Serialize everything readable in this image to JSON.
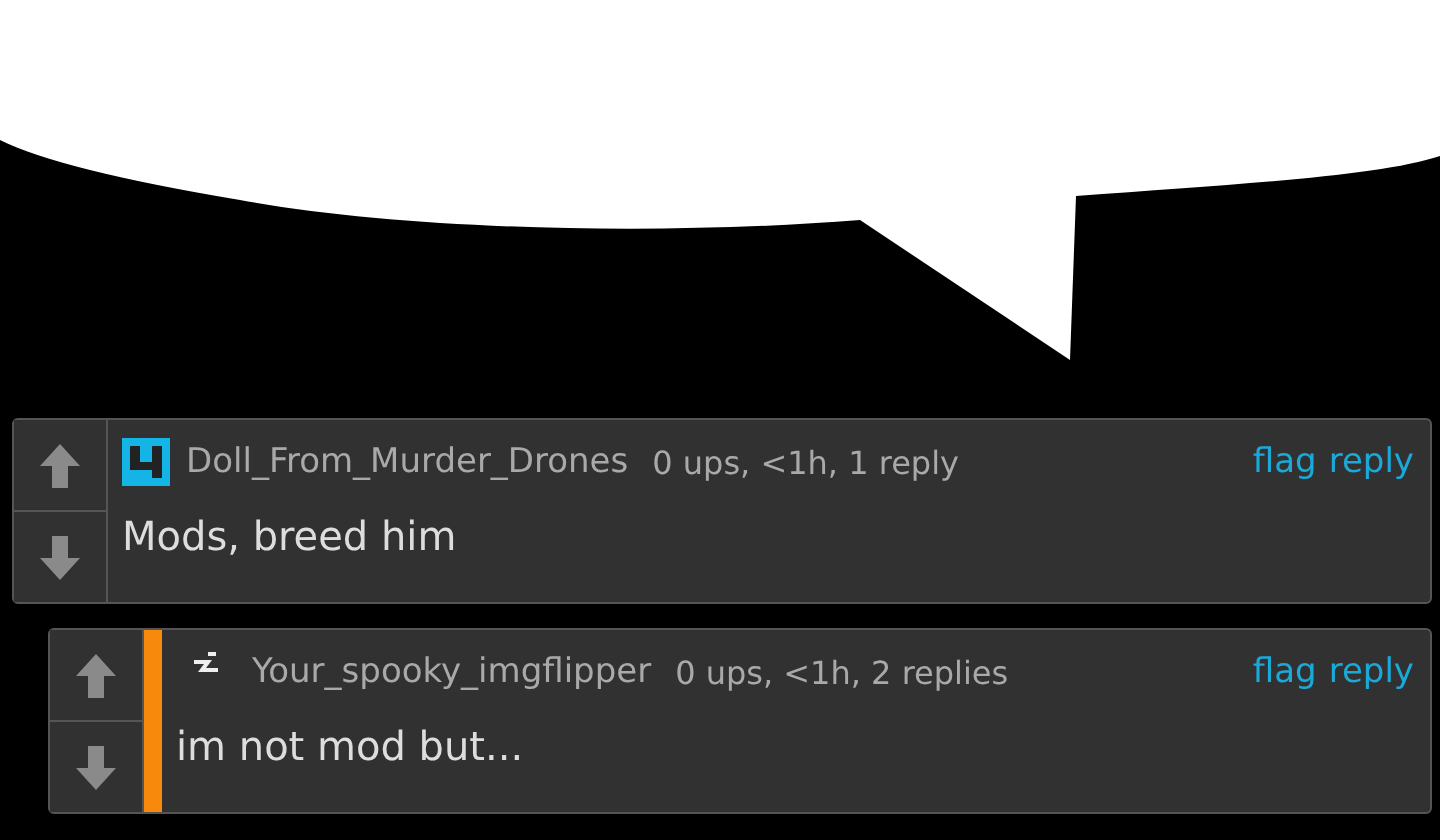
{
  "comments": [
    {
      "avatar": {
        "kind": "block"
      },
      "username": "Doll_From_Murder_Drones",
      "meta": "0 ups, <1h, 1 reply",
      "actions": [
        "flag",
        "reply"
      ],
      "body": "Mods, breed him",
      "children": [
        {
          "avatar": {
            "kind": "glyph"
          },
          "username": "Your_spooky_imgflipper",
          "meta": "0 ups, <1h, 2 replies",
          "actions": [
            "flag",
            "reply"
          ],
          "body": "im not mod but..."
        }
      ]
    }
  ]
}
